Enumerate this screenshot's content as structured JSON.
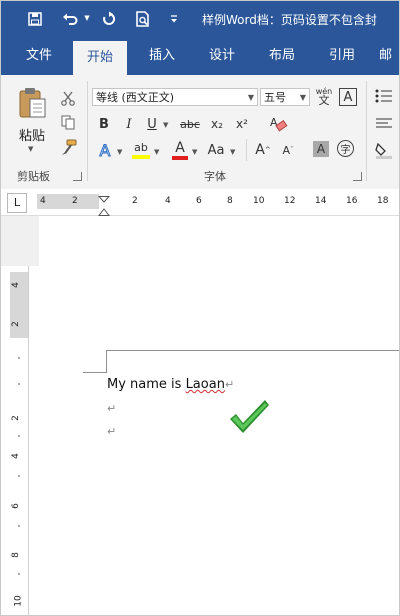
{
  "window": {
    "title": "样例Word档：页码设置不包含封"
  },
  "quick_access": {
    "icons": [
      "save-icon",
      "undo-icon",
      "redo-icon",
      "print-preview-icon",
      "customize-icon"
    ]
  },
  "tabs": [
    {
      "label": "文件",
      "active": false
    },
    {
      "label": "开始",
      "active": true
    },
    {
      "label": "插入",
      "active": false
    },
    {
      "label": "设计",
      "active": false
    },
    {
      "label": "布局",
      "active": false
    },
    {
      "label": "引用",
      "active": false
    },
    {
      "label": "邮",
      "active": false
    }
  ],
  "ribbon": {
    "clipboard": {
      "paste_label": "粘贴",
      "group_label": "剪贴板"
    },
    "font": {
      "font_name": "等线 (西文正文)",
      "font_size": "五号",
      "phonetic_top": "wén",
      "phonetic_bottom": "文",
      "border_char": "A",
      "bold": "B",
      "italic": "I",
      "underline": "U",
      "strike": "abc",
      "subscript": "x₂",
      "superscript": "x²",
      "text_effects": "A",
      "highlight": "ab",
      "font_color": "A",
      "change_case": "Aa",
      "grow": "A",
      "shrink": "A",
      "shading": "A",
      "enclose": "字",
      "group_label": "字体"
    }
  },
  "ruler": {
    "tab_selector": "L",
    "ticks": [
      "4",
      "2",
      "2",
      "4",
      "6",
      "8",
      "10",
      "12",
      "14",
      "16",
      "18"
    ]
  },
  "vruler": {
    "ticks": [
      "4",
      "2",
      "2",
      "4",
      "6",
      "8",
      "10"
    ]
  },
  "document": {
    "lines": [
      {
        "text": "My name is ",
        "misspelled": "Laoan"
      },
      {
        "text": ""
      },
      {
        "text": ""
      }
    ],
    "paragraph_mark": "↵"
  },
  "colors": {
    "ribbon_blue": "#2b579a",
    "highlight_yellow": "#ffff00",
    "font_color_red": "#e02020",
    "check_green": "#3aa53a"
  }
}
